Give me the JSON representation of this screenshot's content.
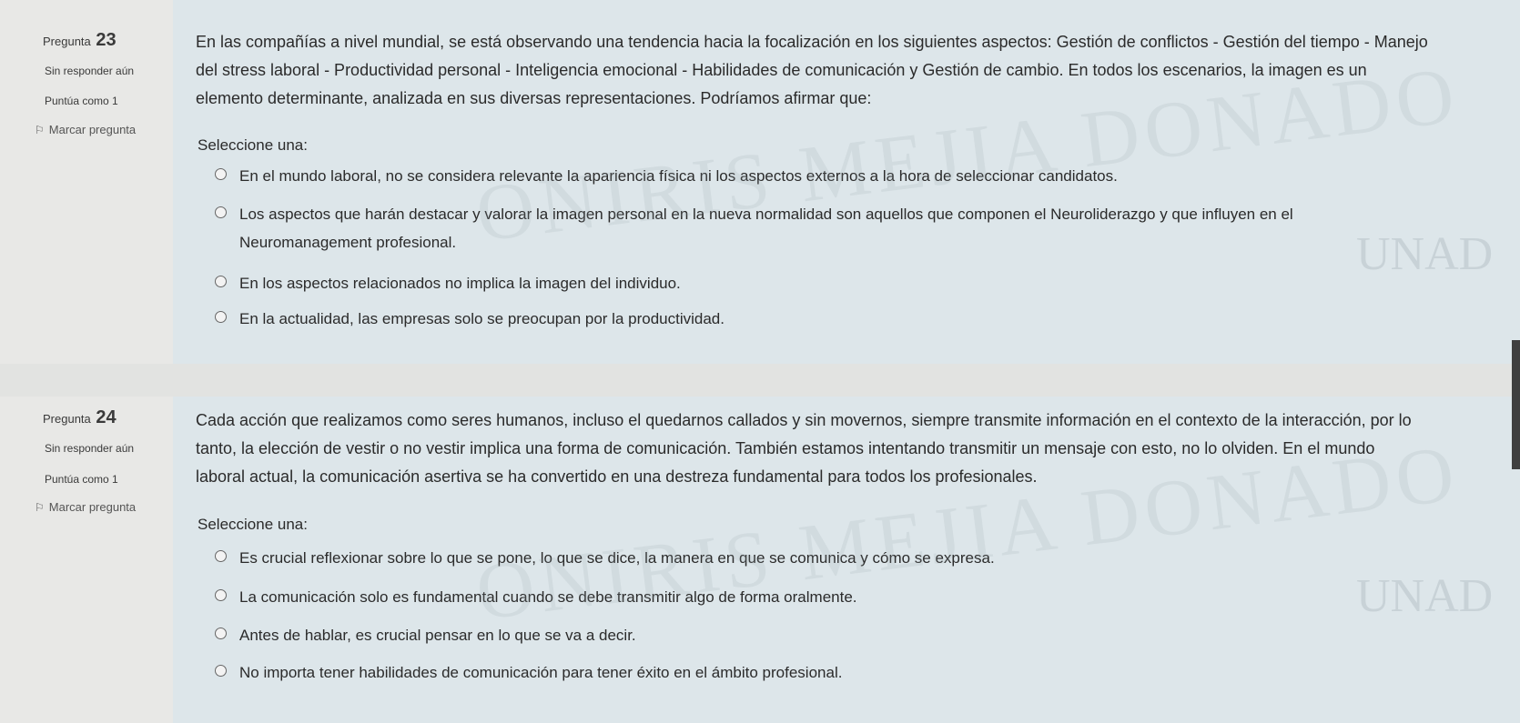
{
  "q23": {
    "number_prefix": "Pregunta",
    "number": "23",
    "state": "Sin responder aún",
    "grade": "Puntúa como 1",
    "flag_label": "Marcar pregunta",
    "text_lines": [
      "En las compañías a nivel mundial, se está observando una tendencia hacia la focalización en los siguientes aspectos: Gestión de conflictos - Gestión del tiempo - Manejo",
      "del stress laboral - Productividad personal - Inteligencia emocional - Habilidades de comunicación y Gestión de cambio. En todos los escenarios, la imagen es un",
      "elemento determinante, analizada en sus diversas representaciones. Podríamos afirmar que:"
    ],
    "prompt": "Seleccione una:",
    "options": [
      "En el mundo laboral, no se considera relevante la apariencia física ni los aspectos externos a la hora de seleccionar candidatos.",
      "Los aspectos que harán destacar y valorar la imagen personal en la nueva normalidad son aquellos que componen el Neuroliderazgo y que influyen en el",
      "Neuromanagement profesional.",
      "En los aspectos relacionados no implica la imagen del individuo.",
      "En la actualidad, las empresas solo se preocupan por la productividad."
    ]
  },
  "q24": {
    "number_prefix": "Pregunta",
    "number": "24",
    "state": "Sin responder aún",
    "grade": "Puntúa como 1",
    "flag_label": "Marcar pregunta",
    "text_lines": [
      "Cada acción que realizamos como seres humanos, incluso el quedarnos callados y sin movernos, siempre transmite información en el contexto de la interacción, por lo",
      "tanto, la elección de vestir o no vestir implica una forma de comunicación. También estamos intentando transmitir un mensaje con esto, no lo olviden. En el mundo",
      "laboral actual, la comunicación asertiva se ha convertido en una destreza fundamental para todos los profesionales."
    ],
    "prompt": "Seleccione una:",
    "options": [
      "Es crucial reflexionar sobre lo que se pone, lo que se dice, la manera en que se comunica y cómo se expresa.",
      "La comunicación solo es fundamental cuando se debe transmitir algo de forma oralmente.",
      "Antes de hablar, es crucial pensar en lo que se va a decir.",
      "No importa tener habilidades de comunicación para tener éxito en el ámbito profesional."
    ]
  },
  "watermark": {
    "name_1": "ONIRIS MEJIA DONADO",
    "name_2": "ONIRIS MEJIA DONADO",
    "logo_1": "UNAD",
    "logo_2": "UNAD"
  },
  "colors": {
    "info_panel": "#e8e8e6",
    "content_panel": "#dde6ea",
    "page_background": "#e2e3e1"
  }
}
